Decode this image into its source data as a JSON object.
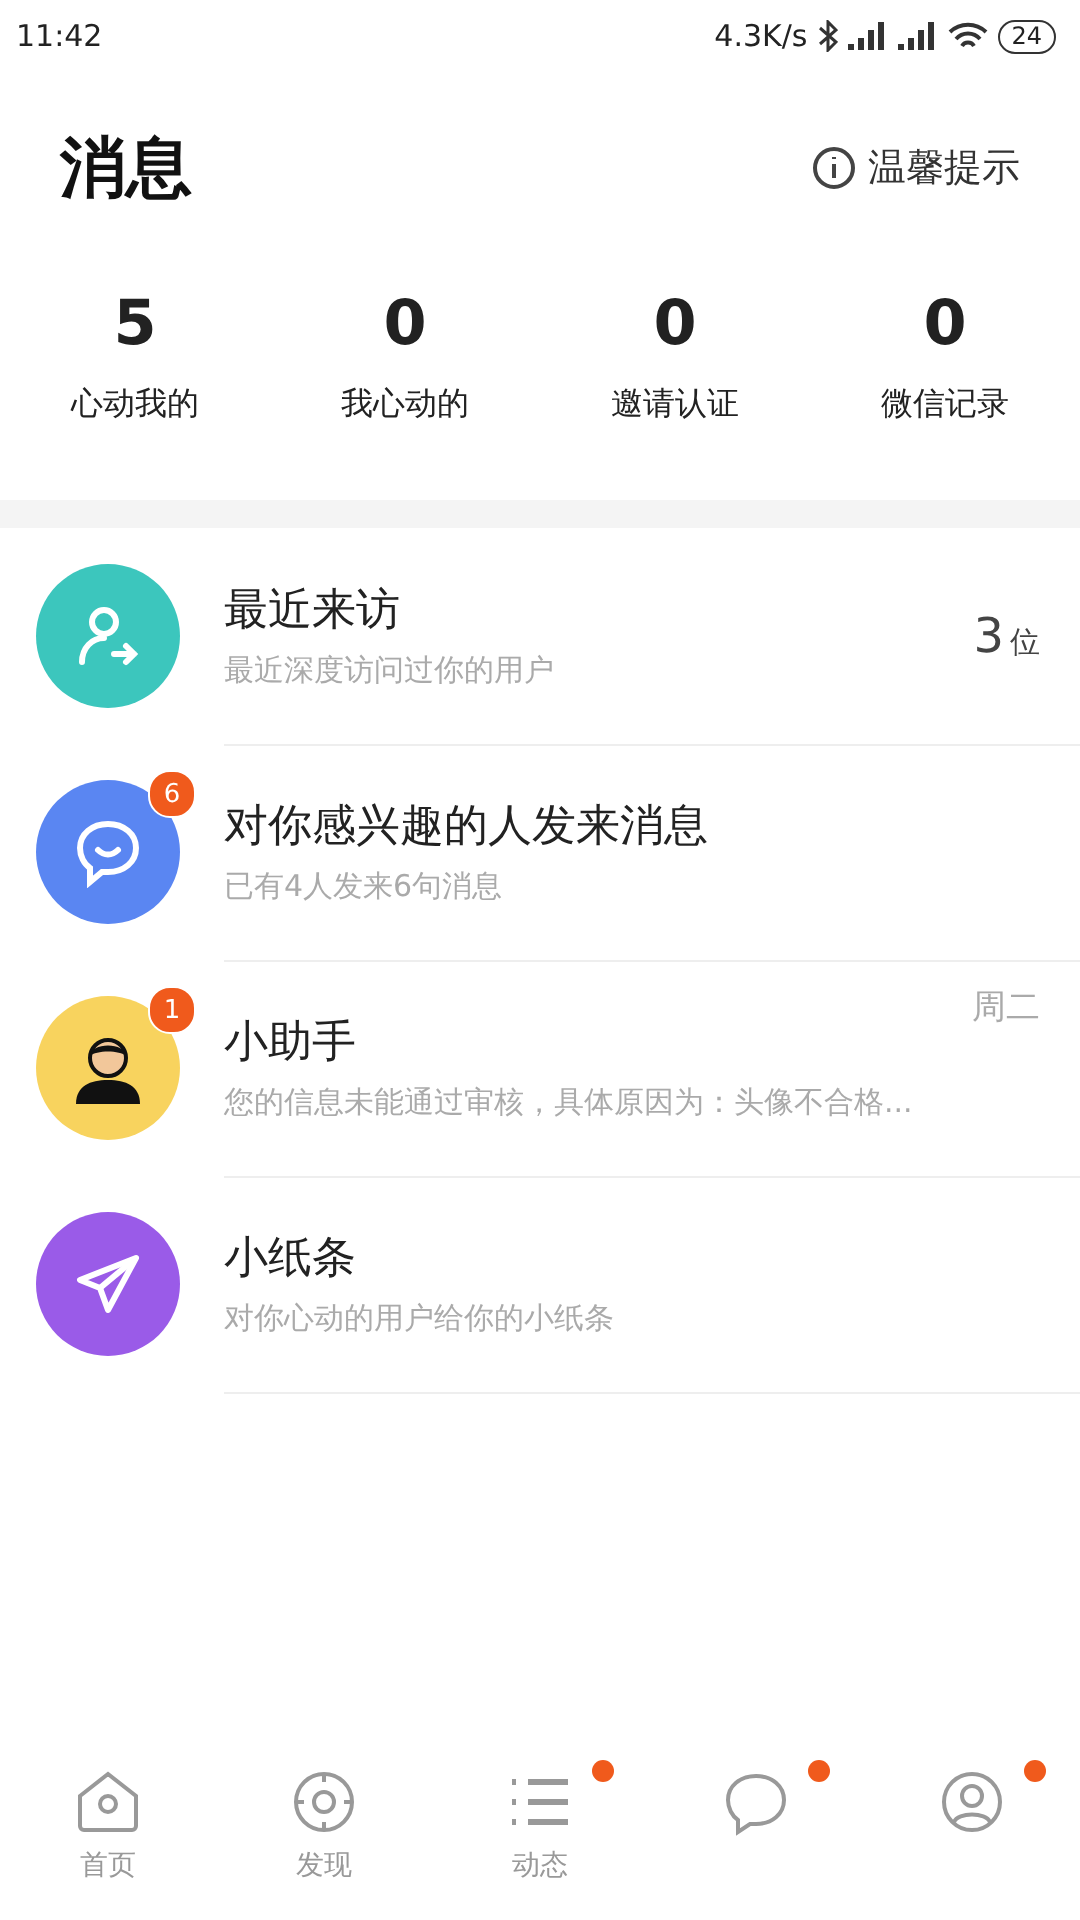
{
  "status_bar": {
    "time": "11:42",
    "speed": "4.3K/s",
    "battery": "24"
  },
  "header": {
    "title": "消息",
    "tip": "温馨提示"
  },
  "stats": [
    {
      "value": "5",
      "label": "心动我的"
    },
    {
      "value": "0",
      "label": "我心动的"
    },
    {
      "value": "0",
      "label": "邀请认证"
    },
    {
      "value": "0",
      "label": "微信记录"
    }
  ],
  "messages": [
    {
      "kind": "visitor",
      "title": "最近来访",
      "subtitle": "最近深度访问过你的用户",
      "count": "3",
      "count_unit": "位",
      "color": "#3cc6bd"
    },
    {
      "kind": "chat",
      "title": "对你感兴趣的人发来消息",
      "subtitle": "已有4人发来6句消息",
      "badge": "6",
      "color": "#5a86f2"
    },
    {
      "kind": "helper",
      "title": "小助手",
      "subtitle": "您的信息未能通过审核，具体原因为：头像不合格...",
      "time": "周二",
      "badge": "1",
      "color": "#f8d35e"
    },
    {
      "kind": "note",
      "title": "小纸条",
      "subtitle": "对你心动的用户给你的小纸条",
      "color": "#9a5be8"
    }
  ],
  "tabs": [
    {
      "kind": "home",
      "label": "首页",
      "selected": false,
      "dot": false
    },
    {
      "kind": "discover",
      "label": "发现",
      "selected": false,
      "dot": false
    },
    {
      "kind": "feed",
      "label": "动态",
      "selected": false,
      "dot": true
    },
    {
      "kind": "chat",
      "selected": false,
      "dot": true
    },
    {
      "kind": "profile",
      "selected": false,
      "dot": true
    }
  ]
}
